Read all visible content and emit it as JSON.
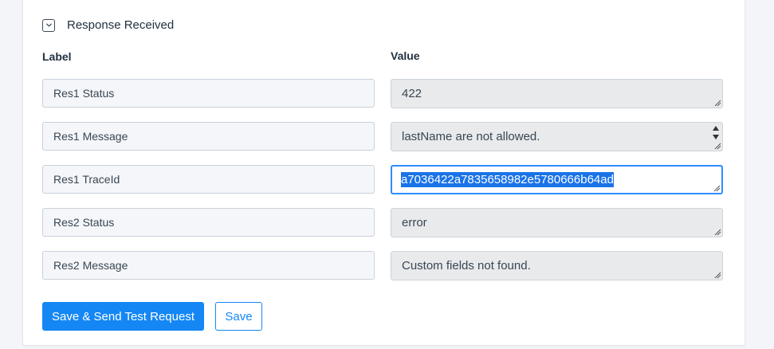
{
  "section": {
    "title": "Response Received",
    "toggle_icon": "chevron-down-icon"
  },
  "columns": {
    "label": "Label",
    "value": "Value"
  },
  "rows": [
    {
      "label": "Res1 Status",
      "value": "422"
    },
    {
      "label": "Res1 Message",
      "value": "lastName are not allowed.",
      "clipped_above": ""
    },
    {
      "label": "Res1 TraceId",
      "value": "a7036422a7835658982e5780666b64ad"
    },
    {
      "label": "Res2 Status",
      "value": "error"
    },
    {
      "label": "Res2 Message",
      "value": "Custom fields not found."
    }
  ],
  "actions": {
    "primary": "Save & Send Test Request",
    "secondary": "Save"
  },
  "colors": {
    "accent": "#1487f4",
    "selection": "#1a73e8",
    "focus_border": "#2e8cff"
  }
}
